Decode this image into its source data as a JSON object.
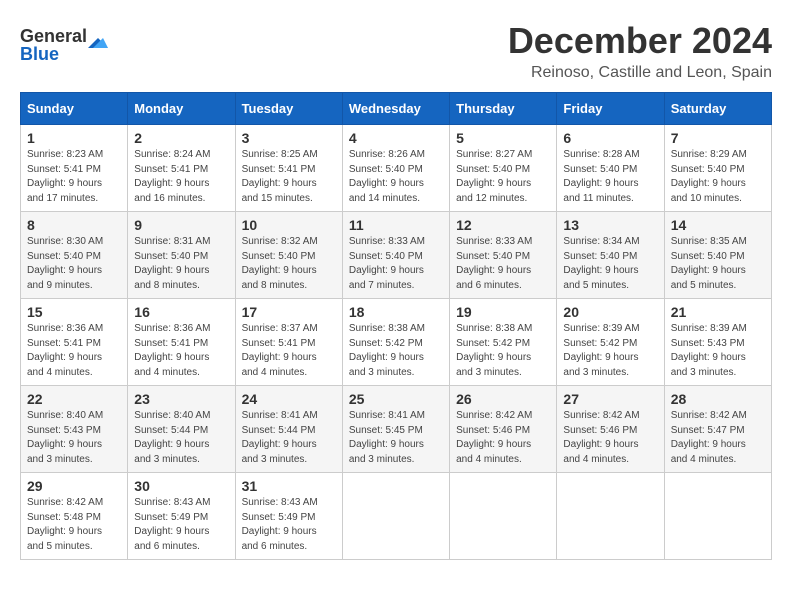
{
  "logo": {
    "line1": "General",
    "line2": "Blue"
  },
  "title": "December 2024",
  "subtitle": "Reinoso, Castille and Leon, Spain",
  "headers": [
    "Sunday",
    "Monday",
    "Tuesday",
    "Wednesday",
    "Thursday",
    "Friday",
    "Saturday"
  ],
  "weeks": [
    [
      {
        "day": "1",
        "sunrise": "8:23 AM",
        "sunset": "5:41 PM",
        "daylight": "9 hours and 17 minutes."
      },
      {
        "day": "2",
        "sunrise": "8:24 AM",
        "sunset": "5:41 PM",
        "daylight": "9 hours and 16 minutes."
      },
      {
        "day": "3",
        "sunrise": "8:25 AM",
        "sunset": "5:41 PM",
        "daylight": "9 hours and 15 minutes."
      },
      {
        "day": "4",
        "sunrise": "8:26 AM",
        "sunset": "5:40 PM",
        "daylight": "9 hours and 14 minutes."
      },
      {
        "day": "5",
        "sunrise": "8:27 AM",
        "sunset": "5:40 PM",
        "daylight": "9 hours and 12 minutes."
      },
      {
        "day": "6",
        "sunrise": "8:28 AM",
        "sunset": "5:40 PM",
        "daylight": "9 hours and 11 minutes."
      },
      {
        "day": "7",
        "sunrise": "8:29 AM",
        "sunset": "5:40 PM",
        "daylight": "9 hours and 10 minutes."
      }
    ],
    [
      {
        "day": "8",
        "sunrise": "8:30 AM",
        "sunset": "5:40 PM",
        "daylight": "9 hours and 9 minutes."
      },
      {
        "day": "9",
        "sunrise": "8:31 AM",
        "sunset": "5:40 PM",
        "daylight": "9 hours and 8 minutes."
      },
      {
        "day": "10",
        "sunrise": "8:32 AM",
        "sunset": "5:40 PM",
        "daylight": "9 hours and 8 minutes."
      },
      {
        "day": "11",
        "sunrise": "8:33 AM",
        "sunset": "5:40 PM",
        "daylight": "9 hours and 7 minutes."
      },
      {
        "day": "12",
        "sunrise": "8:33 AM",
        "sunset": "5:40 PM",
        "daylight": "9 hours and 6 minutes."
      },
      {
        "day": "13",
        "sunrise": "8:34 AM",
        "sunset": "5:40 PM",
        "daylight": "9 hours and 5 minutes."
      },
      {
        "day": "14",
        "sunrise": "8:35 AM",
        "sunset": "5:40 PM",
        "daylight": "9 hours and 5 minutes."
      }
    ],
    [
      {
        "day": "15",
        "sunrise": "8:36 AM",
        "sunset": "5:41 PM",
        "daylight": "9 hours and 4 minutes."
      },
      {
        "day": "16",
        "sunrise": "8:36 AM",
        "sunset": "5:41 PM",
        "daylight": "9 hours and 4 minutes."
      },
      {
        "day": "17",
        "sunrise": "8:37 AM",
        "sunset": "5:41 PM",
        "daylight": "9 hours and 4 minutes."
      },
      {
        "day": "18",
        "sunrise": "8:38 AM",
        "sunset": "5:42 PM",
        "daylight": "9 hours and 3 minutes."
      },
      {
        "day": "19",
        "sunrise": "8:38 AM",
        "sunset": "5:42 PM",
        "daylight": "9 hours and 3 minutes."
      },
      {
        "day": "20",
        "sunrise": "8:39 AM",
        "sunset": "5:42 PM",
        "daylight": "9 hours and 3 minutes."
      },
      {
        "day": "21",
        "sunrise": "8:39 AM",
        "sunset": "5:43 PM",
        "daylight": "9 hours and 3 minutes."
      }
    ],
    [
      {
        "day": "22",
        "sunrise": "8:40 AM",
        "sunset": "5:43 PM",
        "daylight": "9 hours and 3 minutes."
      },
      {
        "day": "23",
        "sunrise": "8:40 AM",
        "sunset": "5:44 PM",
        "daylight": "9 hours and 3 minutes."
      },
      {
        "day": "24",
        "sunrise": "8:41 AM",
        "sunset": "5:44 PM",
        "daylight": "9 hours and 3 minutes."
      },
      {
        "day": "25",
        "sunrise": "8:41 AM",
        "sunset": "5:45 PM",
        "daylight": "9 hours and 3 minutes."
      },
      {
        "day": "26",
        "sunrise": "8:42 AM",
        "sunset": "5:46 PM",
        "daylight": "9 hours and 4 minutes."
      },
      {
        "day": "27",
        "sunrise": "8:42 AM",
        "sunset": "5:46 PM",
        "daylight": "9 hours and 4 minutes."
      },
      {
        "day": "28",
        "sunrise": "8:42 AM",
        "sunset": "5:47 PM",
        "daylight": "9 hours and 4 minutes."
      }
    ],
    [
      {
        "day": "29",
        "sunrise": "8:42 AM",
        "sunset": "5:48 PM",
        "daylight": "9 hours and 5 minutes."
      },
      {
        "day": "30",
        "sunrise": "8:43 AM",
        "sunset": "5:49 PM",
        "daylight": "9 hours and 6 minutes."
      },
      {
        "day": "31",
        "sunrise": "8:43 AM",
        "sunset": "5:49 PM",
        "daylight": "9 hours and 6 minutes."
      },
      null,
      null,
      null,
      null
    ]
  ],
  "labels": {
    "sunrise": "Sunrise:",
    "sunset": "Sunset:",
    "daylight": "Daylight:"
  }
}
